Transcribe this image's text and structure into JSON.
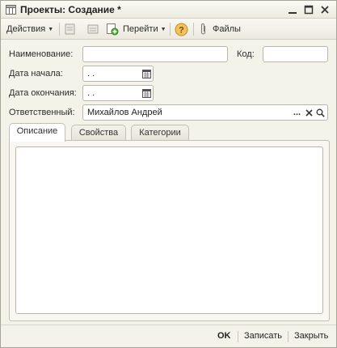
{
  "window": {
    "title": "Проекты: Создание *",
    "minimize_glyph": "—",
    "maximize_glyph": "☐",
    "close_glyph": "✕"
  },
  "toolbar": {
    "actions_label": "Действия",
    "goto_label": "Перейти",
    "help_glyph": "?",
    "files_label": "Файлы"
  },
  "form": {
    "name_label": "Наименование:",
    "name_value": "",
    "code_label": "Код:",
    "code_value": "",
    "start_date_label": "Дата начала:",
    "start_date_value": " .  .",
    "end_date_label": "Дата окончания:",
    "end_date_value": " .  .",
    "responsible_label": "Ответственный:",
    "responsible_value": "Михайлов Андрей",
    "select_glyph": "...",
    "clear_glyph": "✕"
  },
  "tabs": [
    {
      "label": "Описание",
      "active": true
    },
    {
      "label": "Свойства",
      "active": false
    },
    {
      "label": "Категории",
      "active": false
    }
  ],
  "footer": {
    "ok_label": "OK",
    "write_label": "Записать",
    "close_label": "Закрыть"
  },
  "colors": {
    "background": "#f4f3ea",
    "help_icon": "#e8a13a"
  },
  "icons": [
    "window-grid-icon",
    "new-item-icon",
    "list-icon",
    "copy-add-icon",
    "help-icon",
    "paperclip-icon",
    "calendar-icon",
    "search-icon"
  ]
}
